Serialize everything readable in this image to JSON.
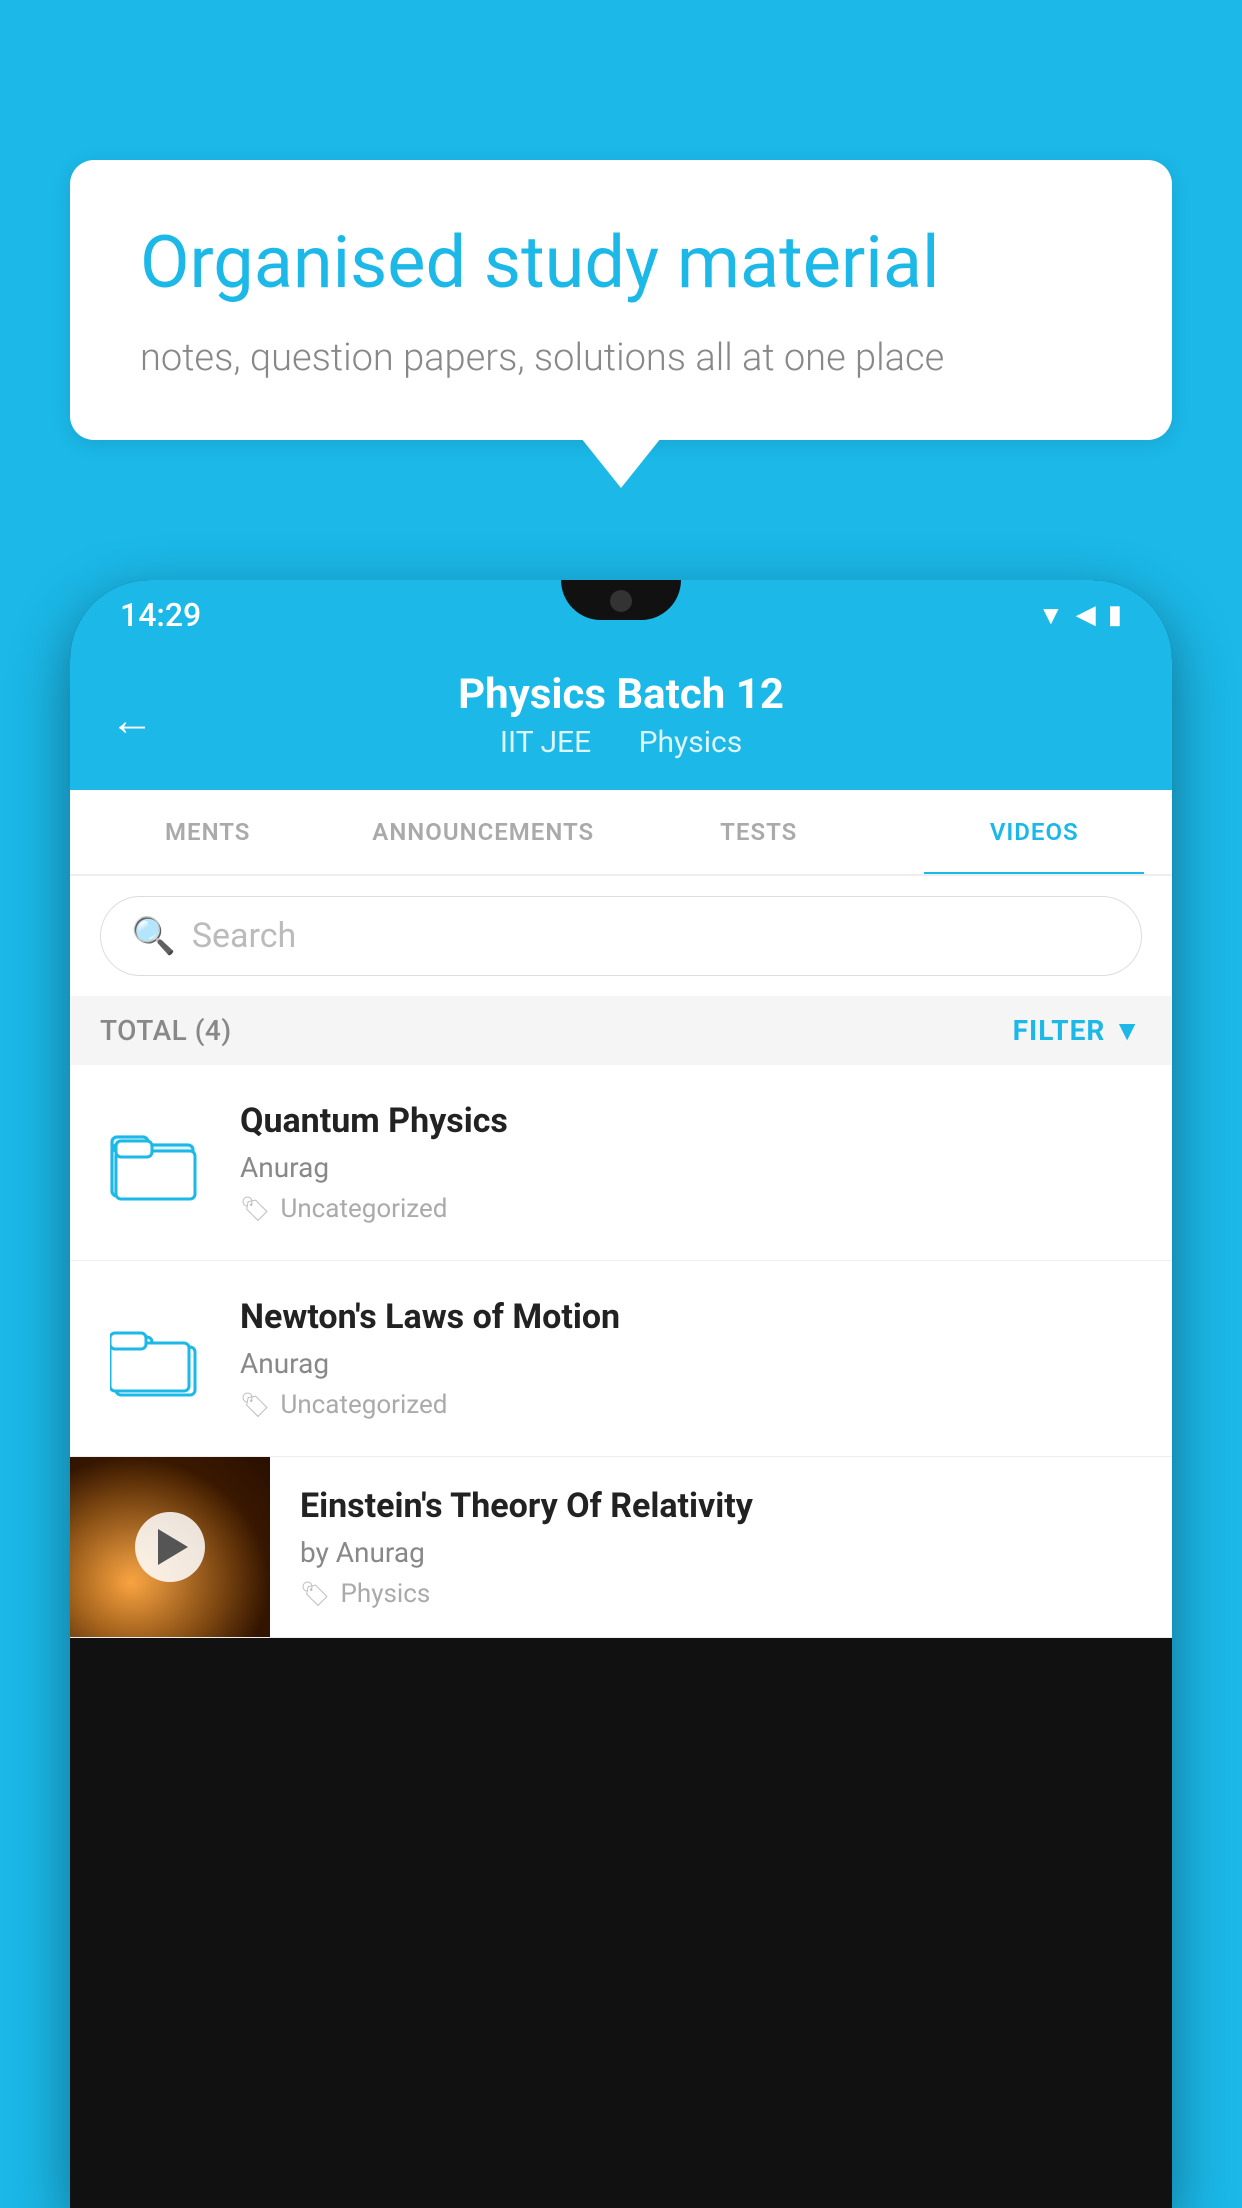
{
  "background_color": "#1BB8E8",
  "speech_bubble": {
    "heading": "Organised study material",
    "subtext": "notes, question papers, solutions all at one place"
  },
  "phone": {
    "status_bar": {
      "time": "14:29",
      "icons": [
        "wifi",
        "signal",
        "battery"
      ]
    },
    "header": {
      "back_label": "←",
      "title": "Physics Batch 12",
      "subtitle_part1": "IIT JEE",
      "subtitle_part2": "Physics"
    },
    "tabs": [
      {
        "label": "MENTS",
        "active": false
      },
      {
        "label": "ANNOUNCEMENTS",
        "active": false
      },
      {
        "label": "TESTS",
        "active": false
      },
      {
        "label": "VIDEOS",
        "active": true
      }
    ],
    "search": {
      "placeholder": "Search"
    },
    "filter_bar": {
      "total_label": "TOTAL (4)",
      "filter_label": "FILTER"
    },
    "videos": [
      {
        "id": 1,
        "title": "Quantum Physics",
        "author": "Anurag",
        "tag": "Uncategorized",
        "type": "folder",
        "has_thumb": false
      },
      {
        "id": 2,
        "title": "Newton's Laws of Motion",
        "author": "Anurag",
        "tag": "Uncategorized",
        "type": "folder",
        "has_thumb": false
      },
      {
        "id": 3,
        "title": "Einstein's Theory Of Relativity",
        "author": "by Anurag",
        "tag": "Physics",
        "type": "video",
        "has_thumb": true
      }
    ]
  }
}
